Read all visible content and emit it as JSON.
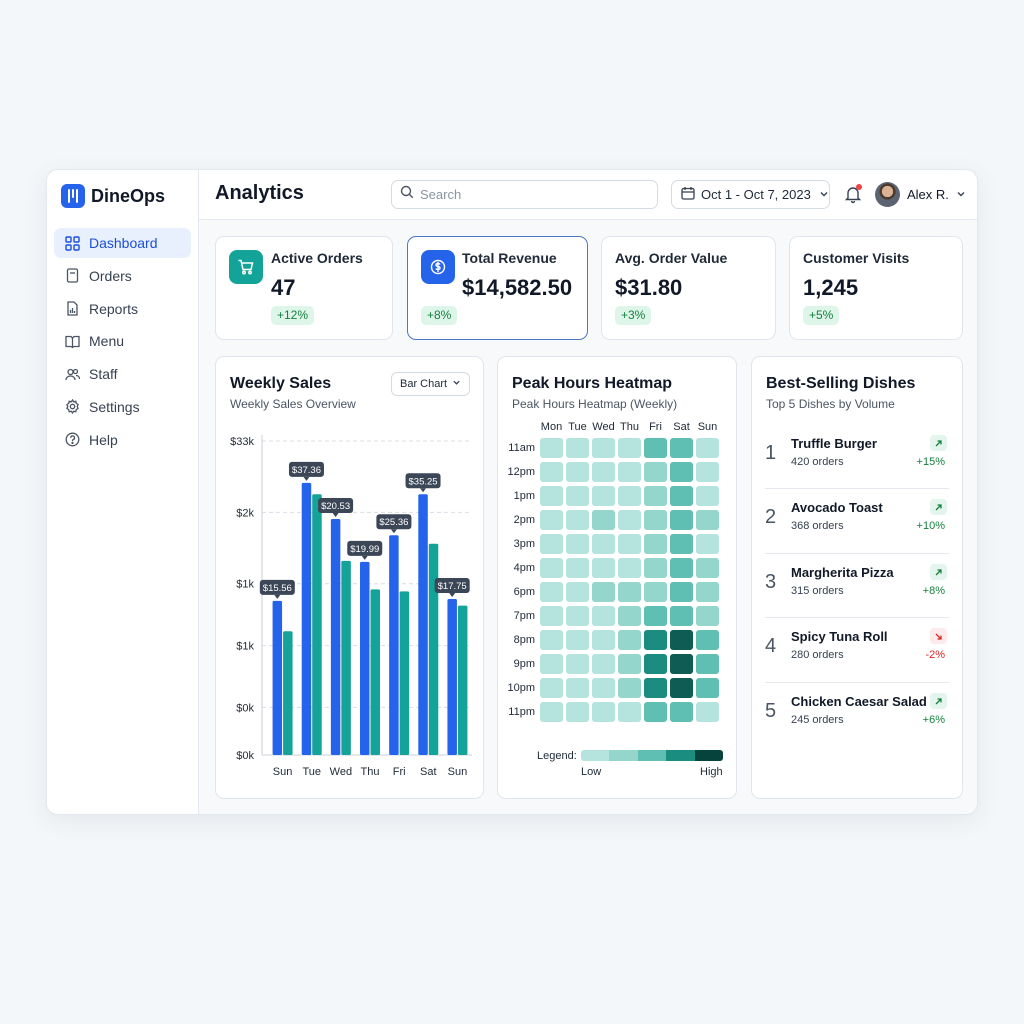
{
  "brand": {
    "name": "DineOps"
  },
  "sidebar": {
    "items": [
      {
        "label": "Dashboard",
        "icon": "grid-icon",
        "active": true
      },
      {
        "label": "Orders",
        "icon": "receipt-icon"
      },
      {
        "label": "Reports",
        "icon": "report-icon"
      },
      {
        "label": "Menu",
        "icon": "book-icon"
      },
      {
        "label": "Staff",
        "icon": "users-icon"
      },
      {
        "label": "Settings",
        "icon": "gear-icon"
      },
      {
        "label": "Help",
        "icon": "help-icon"
      }
    ]
  },
  "header": {
    "title": "Analytics",
    "search_placeholder": "Search",
    "date_range": "Oct 1 - Oct 7, 2023",
    "user_name": "Alex R.",
    "notification_dot": true
  },
  "kpis": [
    {
      "title": "Active Orders",
      "value": "47",
      "change": "+12%",
      "icon": "cart-icon",
      "icon_color": "#14a398"
    },
    {
      "title": "Total Revenue",
      "value": "$14,582.50",
      "change": "+8%",
      "icon": "dollar-icon",
      "icon_color": "#2563eb",
      "highlighted": true
    },
    {
      "title": "Avg. Order Value",
      "value": "$31.80",
      "change": "+3%"
    },
    {
      "title": "Customer Visits",
      "value": "1,245",
      "change": "+5%"
    }
  ],
  "weekly_sales": {
    "title": "Weekly Sales",
    "subtitle": "Weekly Sales Overview",
    "chart_type_label": "Bar Chart"
  },
  "chart_data": {
    "type": "bar",
    "title": "Weekly Sales",
    "subtitle": "Weekly Sales Overview",
    "categories": [
      "Sun",
      "Tue",
      "Wed",
      "Thu",
      "Fri",
      "Sat",
      "Sun"
    ],
    "y_tick_labels": [
      "$33k",
      "$2k",
      "$1k",
      "$1k",
      "$0k",
      "$0k"
    ],
    "y_ticks": [
      33,
      25.5,
      18,
      11.5,
      5,
      0
    ],
    "ylim": [
      0,
      33
    ],
    "series": [
      {
        "values": [
          16.2,
          28.6,
          24.8,
          20.3,
          23.1,
          27.4,
          16.4
        ],
        "color": "#2563eb"
      },
      {
        "values": [
          13.0,
          27.4,
          20.4,
          17.4,
          17.2,
          22.2,
          15.7
        ],
        "color": "#14a398"
      }
    ],
    "data_labels": [
      {
        "index": 0,
        "text": "$15.56"
      },
      {
        "index": 1,
        "text": "$37.36"
      },
      {
        "index": 2,
        "text": "$20.53"
      },
      {
        "index": 3,
        "text": "$19.99"
      },
      {
        "index": 4,
        "text": "$25.36"
      },
      {
        "index": 5,
        "text": "$35.25"
      },
      {
        "index": 6,
        "text": "$17.75"
      }
    ],
    "grid": "dashed-horizontal",
    "legend": "none"
  },
  "heatmap": {
    "title": "Peak Hours Heatmap",
    "subtitle": "Peak Hours Heatmap (Weekly)",
    "days": [
      "Mon",
      "Tue",
      "Wed",
      "Thu",
      "Fri",
      "Sat",
      "Sun"
    ],
    "hours": [
      "11am",
      "12pm",
      "1pm",
      "2pm",
      "3pm",
      "4pm",
      "6pm",
      "7pm",
      "8pm",
      "9pm",
      "10pm",
      "11pm"
    ],
    "levels": [
      [
        1,
        1,
        1,
        1,
        3,
        3,
        1
      ],
      [
        1,
        1,
        1,
        1,
        2,
        3,
        1
      ],
      [
        1,
        1,
        1,
        1,
        2,
        3,
        1
      ],
      [
        1,
        1,
        2,
        1,
        2,
        3,
        2
      ],
      [
        1,
        1,
        1,
        1,
        2,
        3,
        1
      ],
      [
        1,
        1,
        1,
        1,
        2,
        3,
        2
      ],
      [
        1,
        1,
        2,
        2,
        2,
        3,
        2
      ],
      [
        1,
        1,
        1,
        2,
        3,
        3,
        2
      ],
      [
        1,
        1,
        1,
        2,
        4,
        5,
        3
      ],
      [
        1,
        1,
        1,
        2,
        4,
        5,
        3
      ],
      [
        1,
        1,
        1,
        2,
        4,
        5,
        3
      ],
      [
        1,
        1,
        1,
        1,
        3,
        3,
        1
      ]
    ],
    "palette": [
      "#b5e3dd",
      "#b5e3dd",
      "#94d6cc",
      "#5fbfb2",
      "#1b8c80",
      "#0e5c54",
      "#07433d"
    ],
    "legend_label": "Legend:",
    "legend_low": "Low",
    "legend_high": "High"
  },
  "best_selling": {
    "title": "Best-Selling Dishes",
    "subtitle": "Top 5 Dishes by Volume",
    "items": [
      {
        "rank": "1",
        "name": "Truffle Burger",
        "orders": "420 orders",
        "change": "+15%",
        "direction": "up"
      },
      {
        "rank": "2",
        "name": "Avocado Toast",
        "orders": "368 orders",
        "change": "+10%",
        "direction": "up"
      },
      {
        "rank": "3",
        "name": "Margherita Pizza",
        "orders": "315 orders",
        "change": "+8%",
        "direction": "up"
      },
      {
        "rank": "4",
        "name": "Spicy Tuna Roll",
        "orders": "280 orders",
        "change": "-2%",
        "direction": "down"
      },
      {
        "rank": "5",
        "name": "Chicken Caesar Salad",
        "orders": "245 orders",
        "change": "+6%",
        "direction": "up"
      }
    ]
  },
  "colors": {
    "accent": "#2563eb",
    "teal": "#14a398",
    "positive": "#15803d",
    "negative": "#dc2626"
  }
}
